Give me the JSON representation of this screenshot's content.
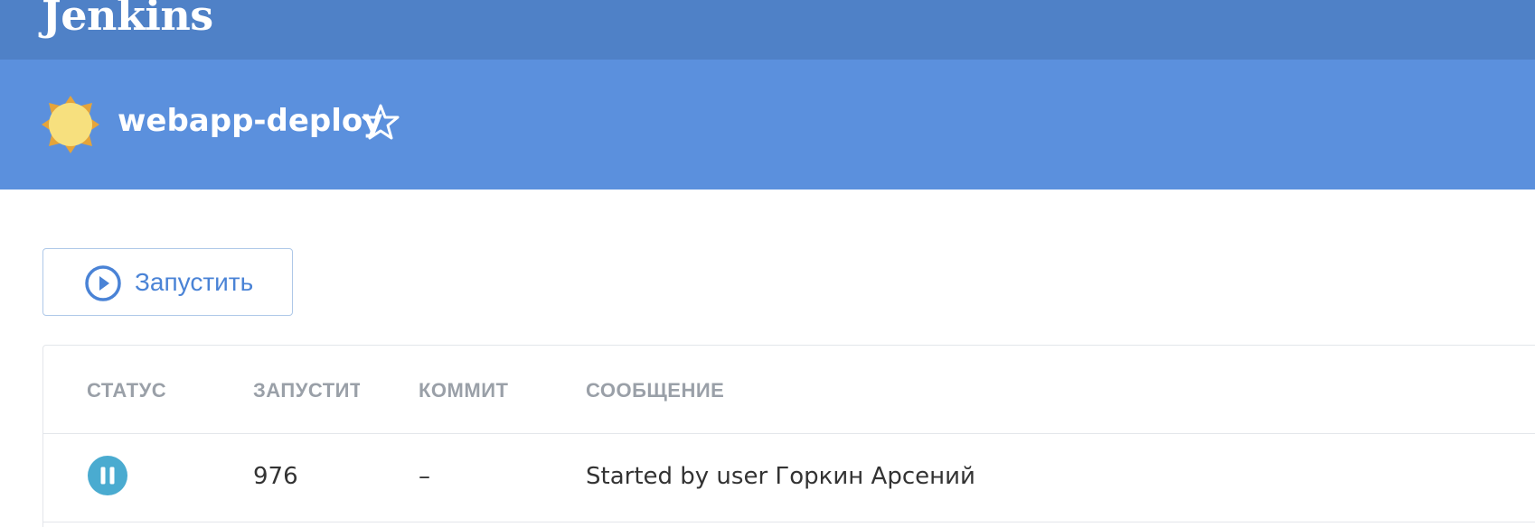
{
  "header": {
    "brand": "Jenkins",
    "background": "#4f81c7"
  },
  "job": {
    "name": "webapp-deploy",
    "weather_icon": "sun-icon",
    "favorite_icon": "star-outline-icon",
    "background": "#5b90dd"
  },
  "actions": {
    "run_label": "Запустить",
    "run_icon": "play-circle-icon"
  },
  "table": {
    "columns": [
      "СТАТУС",
      "ЗАПУСТИТЬ",
      "КОММИТ",
      "СООБЩЕНИЕ"
    ],
    "rows": [
      {
        "status": "paused",
        "status_icon": "pause-circle-icon",
        "run": "976",
        "commit": "–",
        "message": "Started by user Горкин Арсений"
      }
    ]
  },
  "colors": {
    "accent": "#4a83d6",
    "status_paused": "#4aabd0",
    "sun": "#f7e07e",
    "sun_rays": "#e5a43a"
  }
}
